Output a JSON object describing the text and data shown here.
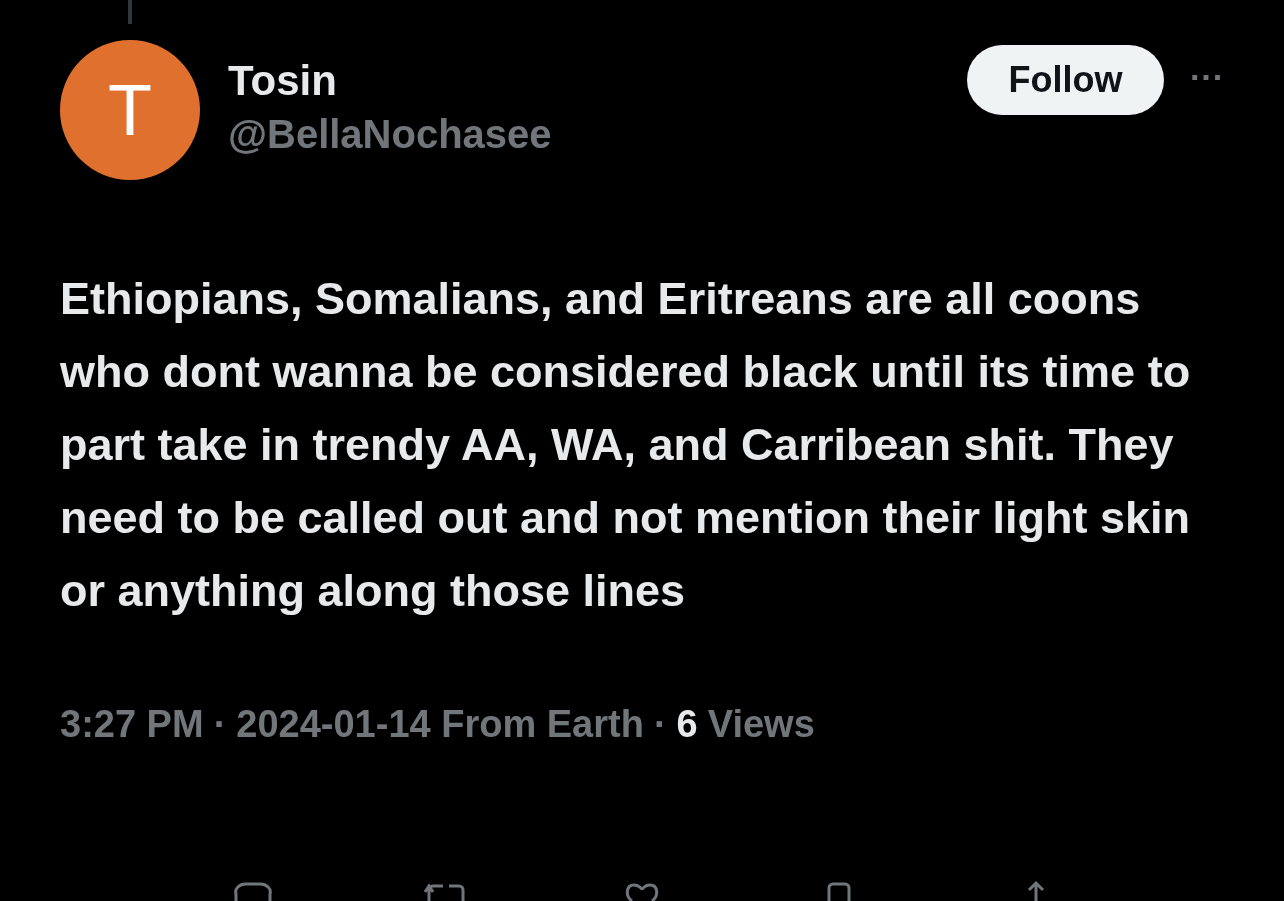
{
  "author": {
    "avatar_letter": "T",
    "name": "Tosin",
    "handle": "@BellaNochasee"
  },
  "follow_button": "Follow",
  "more_button": "···",
  "text": "Ethiopians, Somalians, and Eritreans are all coons who dont wanna be considered black until its time to part take in trendy AA, WA, and Carribean shit. They need to be called out and not mention their light skin or anything along those lines",
  "meta": {
    "time": "3:27 PM",
    "separator_1": "·",
    "date_source": "2024-01-14 From Earth",
    "separator_2": "·",
    "views_count": "6",
    "views_label": "Views"
  },
  "actions": [
    {
      "kind": "reply"
    },
    {
      "kind": "repost"
    },
    {
      "kind": "like"
    },
    {
      "kind": "bookmark"
    },
    {
      "kind": "share"
    }
  ]
}
